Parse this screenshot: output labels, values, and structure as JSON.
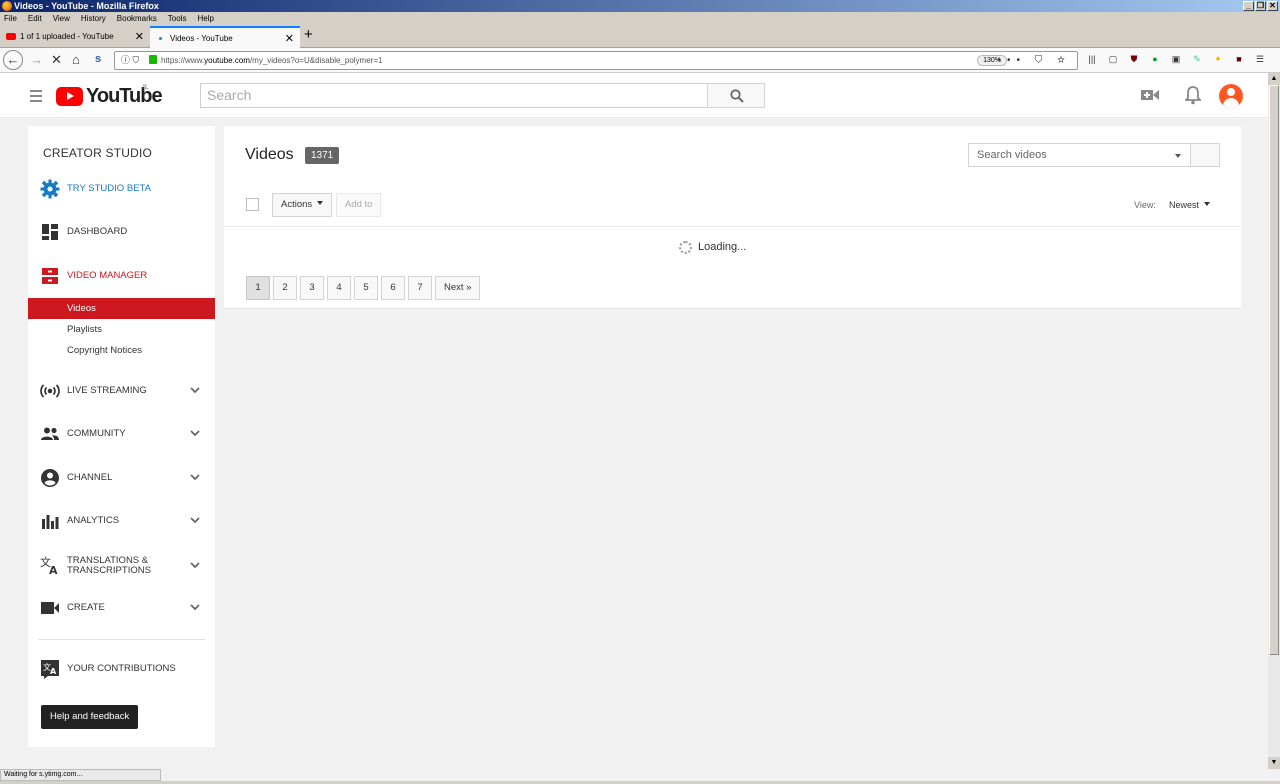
{
  "window": {
    "title": "Videos - YouTube - Mozilla Firefox",
    "controls": [
      "_",
      "❐",
      "✕"
    ]
  },
  "menu": [
    "File",
    "Edit",
    "View",
    "History",
    "Bookmarks",
    "Tools",
    "Help"
  ],
  "tabs": [
    {
      "label": "1 of 1 uploaded - YouTube",
      "close": "✕"
    },
    {
      "label": "Videos - YouTube",
      "close": "✕"
    }
  ],
  "new_tab": "+",
  "browser": {
    "url_prefix": "https://www.",
    "url_domain": "youtube.com",
    "url_path": "/my_videos?o=U&disable_polymer=1",
    "zoom": "130%",
    "url_actions": "••• ⛉ ☆",
    "status": "Waiting for s.ytimg.com..."
  },
  "toolbar_icons": [
    "library-icon",
    "sidebar-icon",
    "ublock-icon",
    "extension-green-icon",
    "extension-badge-icon",
    "extension-color-icon",
    "bulb-icon",
    "extension-dark-icon",
    "hamburger-menu-icon"
  ],
  "masthead": {
    "logo_text": "YouTube",
    "region": "IL",
    "search_placeholder": "Search"
  },
  "sidebar": {
    "title": "CREATOR STUDIO",
    "items": [
      {
        "label": "TRY STUDIO BETA",
        "color": "#167ac6"
      },
      {
        "label": "DASHBOARD"
      },
      {
        "label": "VIDEO MANAGER",
        "color": "#cc181e"
      },
      {
        "label": "LIVE STREAMING"
      },
      {
        "label": "COMMUNITY"
      },
      {
        "label": "CHANNEL"
      },
      {
        "label": "ANALYTICS"
      },
      {
        "label": "TRANSLATIONS &",
        "label2": "TRANSCRIPTIONS"
      },
      {
        "label": "CREATE"
      },
      {
        "label": "YOUR CONTRIBUTIONS"
      }
    ],
    "sub_items": [
      "Videos",
      "Playlists",
      "Copyright Notices"
    ],
    "help_button": "Help and feedback"
  },
  "main": {
    "title": "Videos",
    "count": "1371",
    "search_placeholder": "Search videos",
    "actions_label": "Actions",
    "add_to_label": "Add to",
    "view_label": "View:",
    "sort_label": "Newest",
    "loading_text": "Loading...",
    "pages": [
      "1",
      "2",
      "3",
      "4",
      "5",
      "6",
      "7"
    ],
    "next_label": "Next »"
  }
}
